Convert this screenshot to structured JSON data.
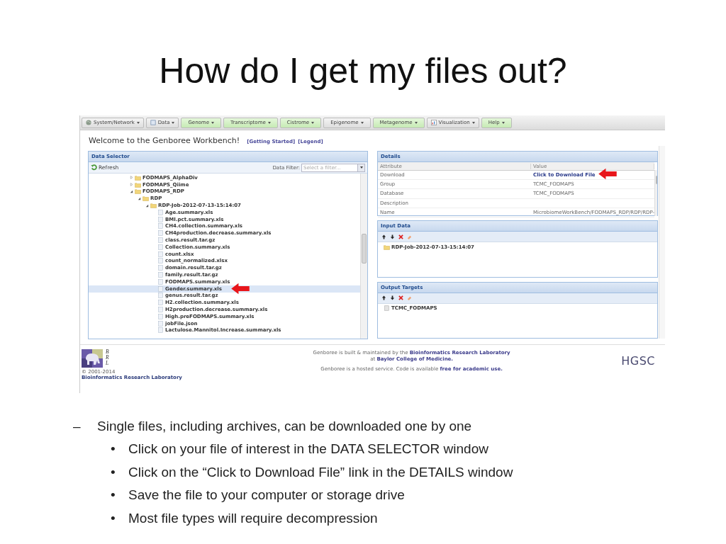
{
  "slide": {
    "title": "How do I get my files out?"
  },
  "menu": [
    {
      "label": "System/Network",
      "kind": "globe"
    },
    {
      "label": "Data",
      "kind": "box"
    },
    {
      "label": "Genome",
      "kind": "green"
    },
    {
      "label": "Transcriptome",
      "kind": "green"
    },
    {
      "label": "Cistrome",
      "kind": "green"
    },
    {
      "label": "Epigenome",
      "kind": "grey"
    },
    {
      "label": "Metagenome",
      "kind": "green"
    },
    {
      "label": "Visualization",
      "kind": "chart"
    },
    {
      "label": "Help",
      "kind": "green"
    }
  ],
  "welcome": {
    "title": "Welcome to the Genboree Workbench!",
    "links": [
      "[Getting Started]",
      "[Legend]"
    ]
  },
  "data_selector": {
    "title": "Data Selector",
    "refresh": "Refresh",
    "filter_label": "Data Filter:",
    "filter_placeholder": "Select a filter...",
    "tree": [
      {
        "label": "FODMAPS_AlphaDiv",
        "kind": "folder",
        "expanded": false,
        "selected": false
      },
      {
        "label": "FODMAPS_Qiime",
        "kind": "folder",
        "expanded": false,
        "selected": false
      },
      {
        "label": "FODMAPS_RDP",
        "kind": "folder",
        "expanded": true,
        "selected": false,
        "children": [
          {
            "label": "RDP",
            "kind": "folder",
            "expanded": true,
            "selected": false,
            "children": [
              {
                "label": "RDP-Job-2012-07-13-15:14:07",
                "kind": "folder",
                "expanded": true,
                "selected": false,
                "children": [
                  {
                    "label": "Age.summary.xls",
                    "kind": "file",
                    "selected": false
                  },
                  {
                    "label": "BMI.pct.summary.xls",
                    "kind": "file",
                    "selected": false
                  },
                  {
                    "label": "CH4.collection.summary.xls",
                    "kind": "file",
                    "selected": false
                  },
                  {
                    "label": "CH4production.decrease.summary.xls",
                    "kind": "file",
                    "selected": false
                  },
                  {
                    "label": "class.result.tar.gz",
                    "kind": "file",
                    "selected": false
                  },
                  {
                    "label": "Collection.summary.xls",
                    "kind": "file",
                    "selected": false
                  },
                  {
                    "label": "count.xlsx",
                    "kind": "file",
                    "selected": false
                  },
                  {
                    "label": "count_normalized.xlsx",
                    "kind": "file",
                    "selected": false
                  },
                  {
                    "label": "domain.result.tar.gz",
                    "kind": "file",
                    "selected": false
                  },
                  {
                    "label": "family.result.tar.gz",
                    "kind": "file",
                    "selected": false
                  },
                  {
                    "label": "FODMAPS.summary.xls",
                    "kind": "file",
                    "selected": false
                  },
                  {
                    "label": "Gender.summary.xls",
                    "kind": "file",
                    "selected": true
                  },
                  {
                    "label": "genus.result.tar.gz",
                    "kind": "file",
                    "selected": false
                  },
                  {
                    "label": "H2.collection.summary.xls",
                    "kind": "file",
                    "selected": false
                  },
                  {
                    "label": "H2production.decrease.summary.xls",
                    "kind": "file",
                    "selected": false
                  },
                  {
                    "label": "High.preFODMAPS.summary.xls",
                    "kind": "file",
                    "selected": false
                  },
                  {
                    "label": "jobFile.json",
                    "kind": "file",
                    "selected": false
                  },
                  {
                    "label": "Lactulose.Mannitol.Increase.summary.xls",
                    "kind": "file",
                    "selected": false
                  }
                ]
              }
            ]
          }
        ]
      }
    ]
  },
  "details": {
    "title": "Details",
    "columns": [
      "Attribute",
      "Value"
    ],
    "rows": [
      {
        "attribute": "Download",
        "value": "Click to Download File",
        "kind": "link"
      },
      {
        "attribute": "Group",
        "value": "TCMC_FODMAPS",
        "kind": "text"
      },
      {
        "attribute": "Database",
        "value": "TCMC_FODMAPS",
        "kind": "text"
      },
      {
        "attribute": "Description"
      },
      {
        "attribute": "Name",
        "value": "MicrobiomeWorkBench/FODMAPS_RDP/RDP/RDP-",
        "kind": "text"
      }
    ]
  },
  "input_data": {
    "title": "Input Data",
    "items": [
      "RDP-Job-2012-07-13-15:14:07"
    ]
  },
  "output_targets": {
    "title": "Output Targets",
    "items": [
      "TCMC_FODMAPS"
    ]
  },
  "footer": {
    "logo_letters": [
      "B",
      "R",
      "L"
    ],
    "copyright": "© 2001-2014",
    "lab": "Bioinformatics Research Laboratory",
    "lines": [
      "Genboree is built & maintained by the **Bioinformatics Research Laboratory**",
      "at **Baylor College of Medicine.**",
      "Genboree is a hosted service. Code is available **free for academic use.**"
    ],
    "partner_logo": "HGSC"
  },
  "bullets": [
    {
      "marker": "–",
      "text": "Single files, including archives, can be downloaded one by one",
      "children": [
        {
          "marker": "•",
          "text": "Click on your file of interest in the DATA SELECTOR window"
        },
        {
          "marker": "•",
          "text": "Click on the “Click to Download File” link in the DETAILS window"
        },
        {
          "marker": "•",
          "text": "Save the file to your computer or storage drive"
        },
        {
          "marker": "•",
          "text": "Most file types will require decompression"
        }
      ]
    }
  ]
}
